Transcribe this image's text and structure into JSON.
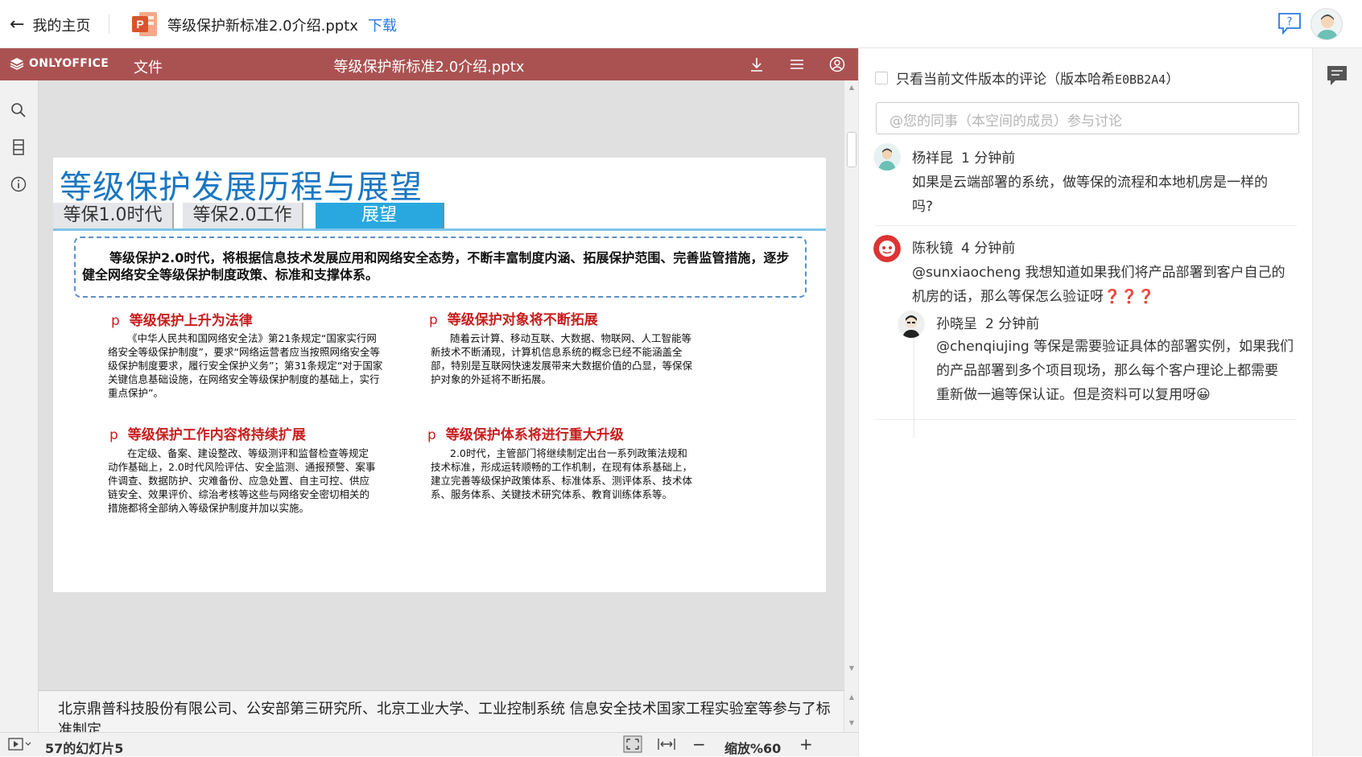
{
  "topbar": {
    "back_label": "我的主页",
    "file_name": "等级保护新标准2.0介绍.pptx",
    "download_label": "下载"
  },
  "editor": {
    "logo_text": "ONLYOFFICE",
    "file_menu": "文件",
    "title": "等级保护新标准2.0介绍.pptx",
    "header_color": "#aa5252"
  },
  "slide": {
    "title": "等级保护发展历程与展望",
    "tabs": [
      "等保1.0时代",
      "等保2.0工作",
      "展望"
    ],
    "active_tab": "展望",
    "intro": "等级保护2.0时代，将根据信息技术发展应用和网络安全态势，不断丰富制度内涵、拓展保护范围、完善监管措施，逐步健全网络安全等级保护制度政策、标准和支撑体系。",
    "bullet_marker": "p",
    "sections": [
      {
        "title": "等级保护上升为法律",
        "body": "《中华人民共和国网络安全法》第21条规定“国家实行网络安全等级保护制度”，要求“网络运营者应当按照网络安全等级保护制度要求，履行安全保护义务”；第31条规定“对于国家关键信息基础设施，在网络安全等级保护制度的基础上，实行重点保护”。"
      },
      {
        "title": "等级保护对象将不断拓展",
        "body": "随着云计算、移动互联、大数据、物联网、人工智能等新技术不断涌现，计算机信息系统的概念已经不能涵盖全部，特别是互联网快速发展带来大数据价值的凸显，等保保护对象的外延将不断拓展。"
      },
      {
        "title": "等级保护工作内容将持续扩展",
        "body": "在定级、备案、建设整改、等级测评和监督检查等规定动作基础上，2.0时代风险评估、安全监测、通报预警、案事件调查、数据防护、灾难备份、应急处置、自主可控、供应链安全、效果评价、综治考核等这些与网络安全密切相关的措施都将全部纳入等级保护制度并加以实施。"
      },
      {
        "title": "等级保护体系将进行重大升级",
        "body": "2.0时代，主管部门将继续制定出台一系列政策法规和技术标准，形成运转顺畅的工作机制，在现有体系基础上，建立完善等级保护政策体系、标准体系、测评体系、技术体系、服务体系、关键技术研究体系、教育训练体系等。"
      }
    ]
  },
  "notes": {
    "text": "北京鼎普科技股份有限公司、公安部第三研究所、北京工业大学、工业控制系统 信息安全技术国家工程实验室等参与了标准制定"
  },
  "status": {
    "slide_counter": "57的幻灯片5",
    "zoom": "缩放%60"
  },
  "comments": {
    "filter_label": "只看当前文件版本的评论（版本哈希",
    "filter_hash": "E0BB2A4",
    "filter_close": "）",
    "input_placeholder": "@您的同事（本空间的成员）参与讨论",
    "items": [
      {
        "author": "杨祥昆",
        "time": "1 分钟前",
        "text_line1": "如果是云端部署的系统，做等保的流程和本地机房是一样的",
        "text_line2": "吗?"
      },
      {
        "author": "陈秋镜",
        "time": "4 分钟前",
        "text_line1": "@sunxiaocheng 我想知道如果我们将产品部署到客户自己的",
        "text_line2": "机房的话，那么等保怎么验证呀❓❓❓"
      },
      {
        "author": "孙晓呈",
        "time": "2 分钟前",
        "text_line1": "@chenqiujing 等保是需要验证具体的部署实例，如果我们",
        "text_line2": "的产品部署到多个项目现场，那么每个客户理论上都需要",
        "text_line3": "重新做一遍等保认证。但是资料可以复用呀😀"
      }
    ]
  }
}
